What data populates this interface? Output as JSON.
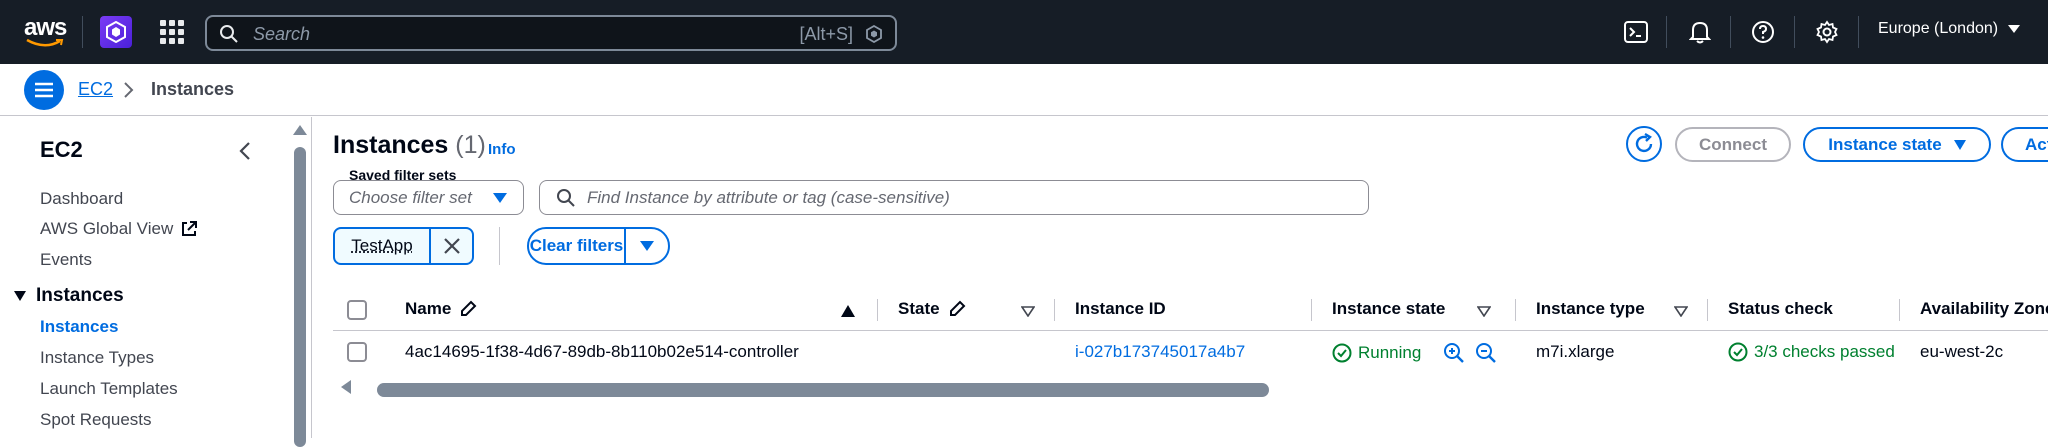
{
  "topnav": {
    "logo_text": "aws",
    "search_placeholder": "Search",
    "search_shortcut": "[Alt+S]",
    "region": "Europe (London)"
  },
  "breadcrumb": {
    "service": "EC2",
    "current": "Instances"
  },
  "sidebar": {
    "title": "EC2",
    "links": [
      "Dashboard",
      "AWS Global View",
      "Events"
    ],
    "section": "Instances",
    "section_links": [
      "Instances",
      "Instance Types",
      "Launch Templates",
      "Spot Requests"
    ]
  },
  "main": {
    "title": "Instances",
    "count": "(1)",
    "info": "Info",
    "connect_label": "Connect",
    "instance_state_label": "Instance state",
    "actions_label": "Actions",
    "saved_filter_label": "Saved filter sets",
    "saved_filter_placeholder": "Choose filter set",
    "find_placeholder": "Find Instance by attribute or tag (case-sensitive)",
    "filter_token": "TestApp",
    "clear_filters_label": "Clear filters"
  },
  "table": {
    "columns": [
      "Name",
      "State",
      "Instance ID",
      "Instance state",
      "Instance type",
      "Status check",
      "Availability Zone"
    ],
    "rows": [
      {
        "name": "4ac14695-1f38-4d67-89db-8b110b02e514-controller",
        "instance_id": "i-027b173745017a4b7",
        "instance_state": "Running",
        "instance_type": "m7i.xlarge",
        "status_check": "3/3 checks passed",
        "availability_zone": "eu-west-2c"
      }
    ]
  },
  "colors": {
    "nav_bg": "#161d26",
    "accent": "#006ce0",
    "success": "#00802f"
  }
}
